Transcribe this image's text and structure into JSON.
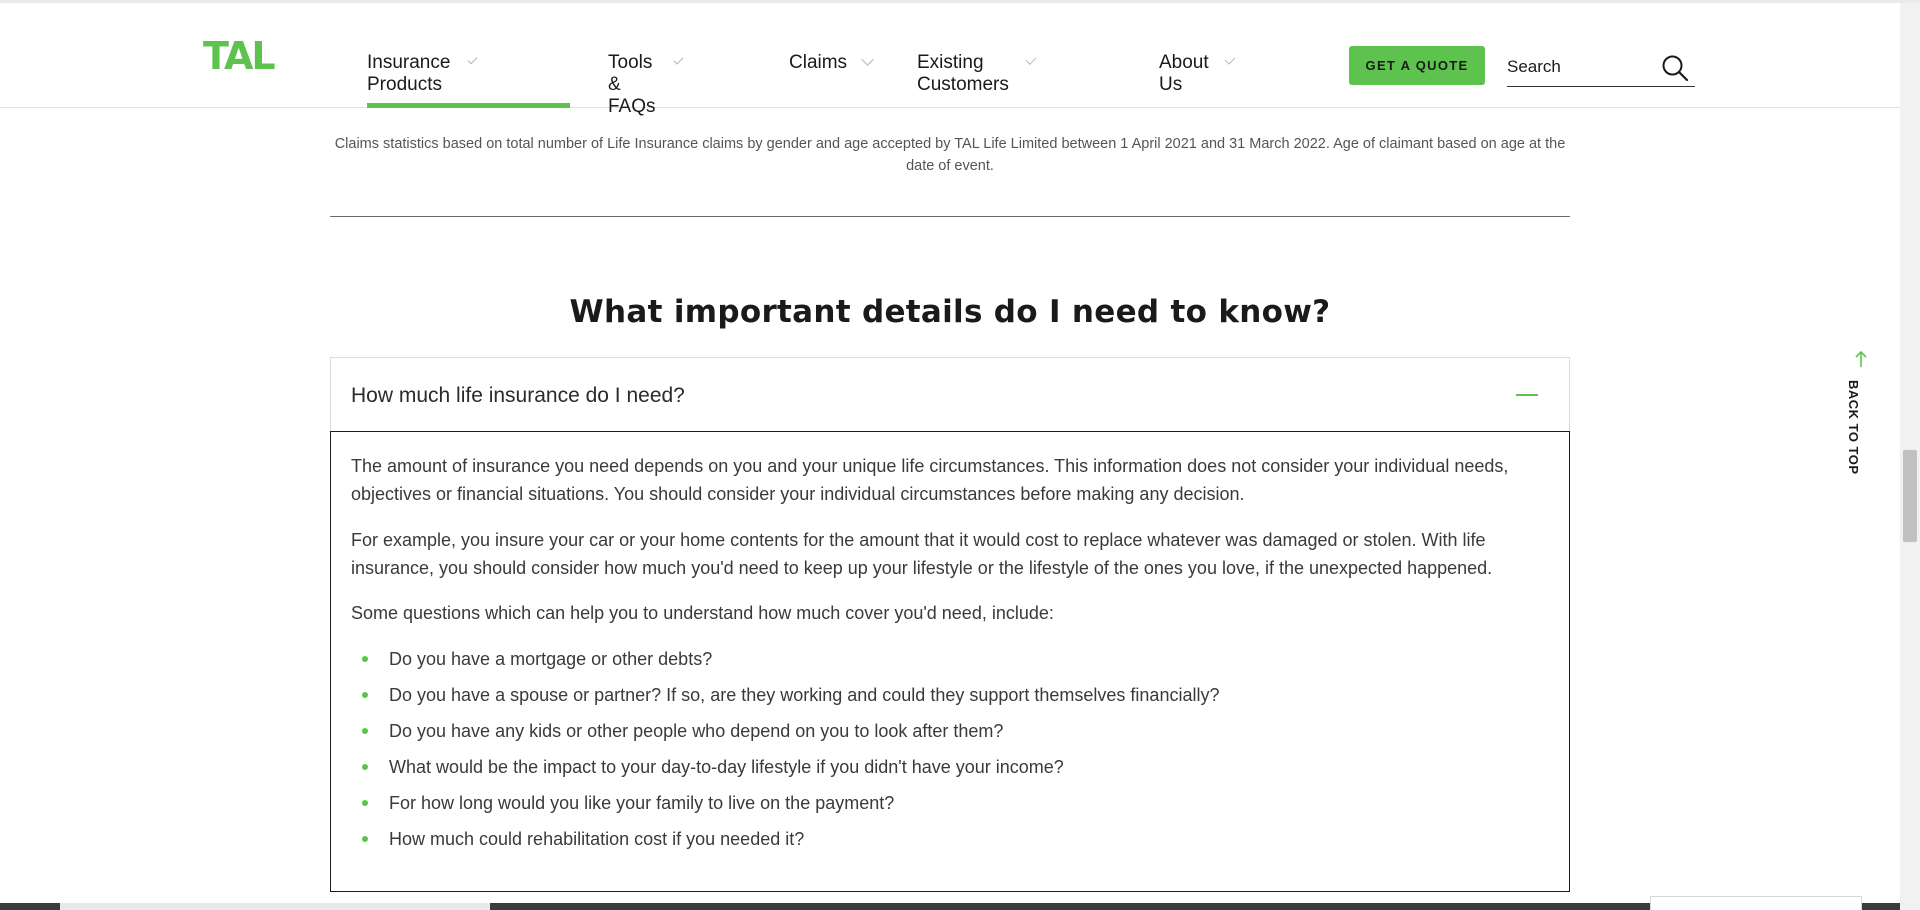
{
  "brand": {
    "logo_text": "TAL",
    "accent_color": "#5ec24e"
  },
  "nav": {
    "items": [
      {
        "label": "Insurance Products",
        "active": true
      },
      {
        "label": "Tools & FAQs"
      },
      {
        "label": "Claims"
      },
      {
        "label": "Existing Customers"
      },
      {
        "label": "About Us"
      }
    ],
    "quote_label": "GET A QUOTE",
    "search_placeholder": "Search"
  },
  "content": {
    "disclaimer": "Claims statistics based on total number of Life Insurance claims by gender and age accepted by TAL Life Limited between 1 April 2021 and 31 March 2022. Age of claimant based on age at the date of event.",
    "section_title": "What important details do I need to know?",
    "accordion": {
      "question": "How much life insurance do I need?",
      "expanded": true,
      "paragraphs": [
        "The amount of insurance you need depends on you and your unique life circumstances.  This information does not consider your individual needs, objectives or financial situations.  You should consider your individual circumstances before making any decision.",
        "For example, you insure your car or your home contents for the amount that it would cost to replace whatever was damaged or stolen. With life insurance, you should consider how much you'd need to keep up your lifestyle or the lifestyle of the ones you love, if the unexpected happened.",
        "Some questions which can help you to understand how much cover you'd need, include:"
      ],
      "bullets": [
        "Do you have a mortgage or other debts?",
        "Do you have a spouse or partner? If so, are they working and could they support themselves financially?",
        "Do you have any kids or other people who depend on you to look after them?",
        "What would be the impact to your day-to-day lifestyle if you didn't have your income?",
        "For how long would you like your family to live on the payment?",
        "How much could rehabilitation cost if you needed it?"
      ]
    }
  },
  "back_to_top": "BACK TO TOP",
  "icons": [
    "search-icon",
    "chevron-down-icon",
    "minus-icon",
    "arrow-up-icon"
  ]
}
